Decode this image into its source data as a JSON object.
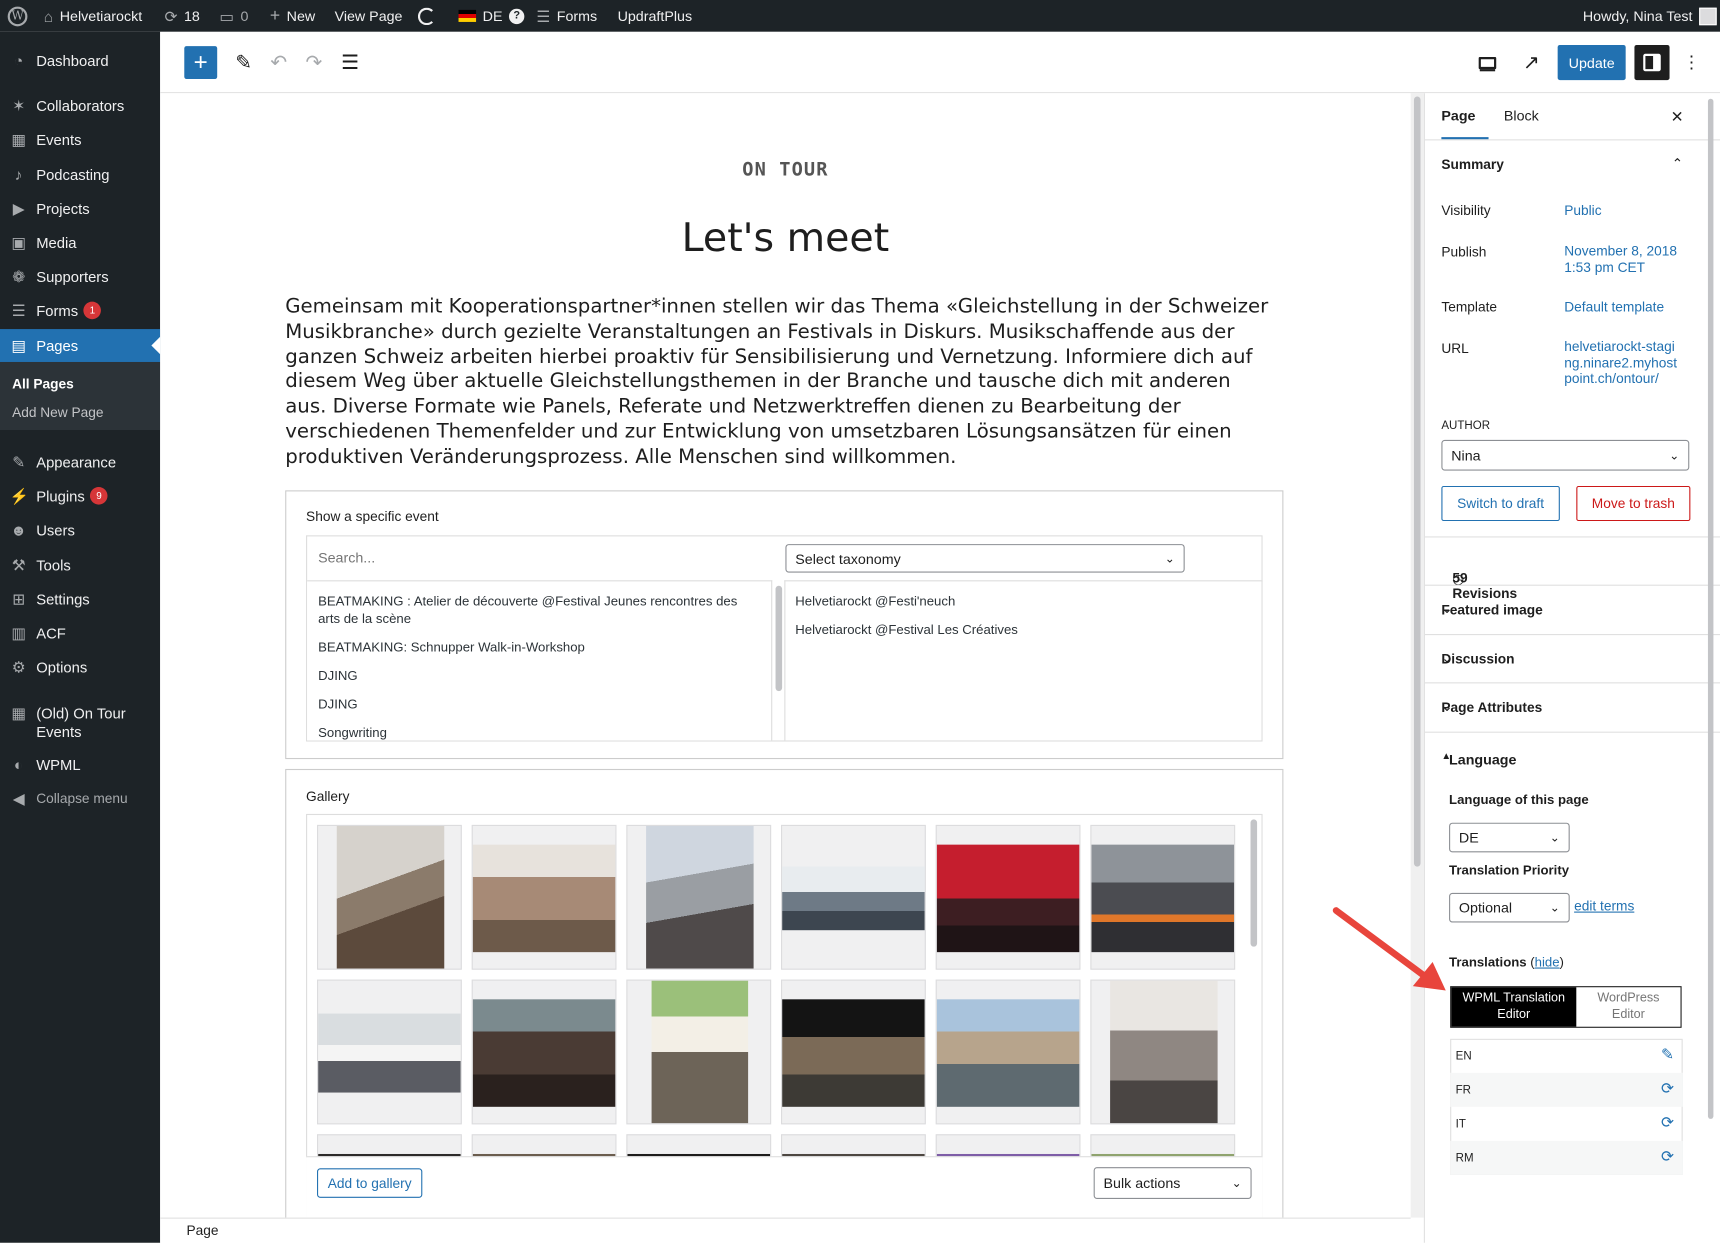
{
  "admin_bar": {
    "site_name": "Helvetiarockt",
    "updates_count": "18",
    "comments_count": "0",
    "new_label": "New",
    "view_page_label": "View Page",
    "language": "DE",
    "forms_label": "Forms",
    "updraft_label": "UpdraftPlus",
    "greeting": "Howdy, Nina Test"
  },
  "sidebar": {
    "items": [
      {
        "label": "Dashboard",
        "icon": "dashboard-icon"
      },
      {
        "label": "Collaborators",
        "icon": "pin-icon"
      },
      {
        "label": "Events",
        "icon": "calendar-icon"
      },
      {
        "label": "Podcasting",
        "icon": "microphone-icon"
      },
      {
        "label": "Projects",
        "icon": "play-icon"
      },
      {
        "label": "Media",
        "icon": "media-icon"
      },
      {
        "label": "Supporters",
        "icon": "groups-icon"
      },
      {
        "label": "Forms",
        "icon": "forms-icon",
        "badge": "1"
      },
      {
        "label": "Pages",
        "icon": "pages-icon"
      },
      {
        "label": "Appearance",
        "icon": "brush-icon"
      },
      {
        "label": "Plugins",
        "icon": "plugin-icon",
        "badge": "9"
      },
      {
        "label": "Users",
        "icon": "user-icon"
      },
      {
        "label": "Tools",
        "icon": "wrench-icon"
      },
      {
        "label": "Settings",
        "icon": "settings-icon"
      },
      {
        "label": "ACF",
        "icon": "table-icon"
      },
      {
        "label": "Options",
        "icon": "gear-icon"
      },
      {
        "label": "(Old) On Tour Events",
        "icon": "calendar-icon"
      },
      {
        "label": "WPML",
        "icon": "wpml-icon"
      },
      {
        "label": "Collapse menu",
        "icon": "collapse-icon"
      }
    ],
    "submenu": [
      "All Pages",
      "Add New Page"
    ]
  },
  "toolbar": {
    "update_label": "Update"
  },
  "canvas": {
    "kicker": "ON TOUR",
    "title": "Let's meet",
    "intro": "Gemeinsam mit Kooperationspartner*innen stellen wir das Thema «Gleichstellung in der Schweizer Musikbranche» durch gezielte Veranstaltungen an Festivals in Diskurs. Musikschaffende aus der ganzen Schweiz arbeiten hierbei proaktiv für Sensibilisierung und Vernetzung. Informiere dich auf diesem Weg über aktuelle Gleichstellungsthemen in der Branche und tausche dich mit anderen aus. Diverse Formate wie Panels, Referate und Netzwerktreffen dienen zu Bearbeitung der verschiedenen Themenfelder und zur Entwicklung von umsetzbaren Lösungsansätzen für einen produktiven Veränderungsprozess. Alle Menschen sind willkommen.",
    "events_block": {
      "label": "Show a specific event",
      "search_placeholder": "Search...",
      "taxonomy_value": "Select taxonomy",
      "available": [
        "BEATMAKING : Atelier de découverte @Festival Jeunes rencontres des arts de la scène",
        "BEATMAKING: Schnupper Walk-in-Workshop",
        "DJING",
        "DJING",
        "Songwriting"
      ],
      "selected": [
        "Helvetiarockt @Festi'neuch",
        "Helvetiarockt @Festival Les Créatives"
      ]
    },
    "gallery": {
      "label": "Gallery",
      "add_label": "Add to gallery",
      "bulk_value": "Bulk actions"
    }
  },
  "status_bar": {
    "breadcrumb": "Page"
  },
  "panel": {
    "tabs": [
      "Page",
      "Block"
    ],
    "summary_label": "Summary",
    "visibility_label": "Visibility",
    "visibility_value": "Public",
    "publish_label": "Publish",
    "publish_value": "November 8, 2018 1:53 pm CET",
    "template_label": "Template",
    "template_value": "Default template",
    "url_label": "URL",
    "url_value": "helvetiarockt-staging.ninare2.myhostpoint.ch/ontour/",
    "author_label": "AUTHOR",
    "author_value": "Nina",
    "switch_draft_label": "Switch to draft",
    "trash_label": "Move to trash",
    "revisions_label": "59 Revisions",
    "featured_image_label": "Featured image",
    "discussion_label": "Discussion",
    "page_attributes_label": "Page Attributes",
    "language_label": "Language",
    "language_of_page_label": "Language of this page",
    "language_value": "DE",
    "priority_label": "Translation Priority",
    "priority_value": "Optional",
    "edit_terms_label": "edit terms",
    "translations_label": "Translations",
    "hide_label": "hide",
    "wpml_editor_label": "WPML Translation Editor",
    "wp_editor_label": "WordPress Editor",
    "translations": [
      {
        "lang": "EN",
        "icon": "pencil-icon"
      },
      {
        "lang": "FR",
        "icon": "refresh-icon"
      },
      {
        "lang": "IT",
        "icon": "refresh-icon"
      },
      {
        "lang": "RM",
        "icon": "refresh-icon"
      }
    ]
  },
  "colors": {
    "accent": "#2271b1",
    "admin_bg": "#1d2327",
    "annotation_arrow": "#e8453c",
    "danger": "#cc1818"
  }
}
